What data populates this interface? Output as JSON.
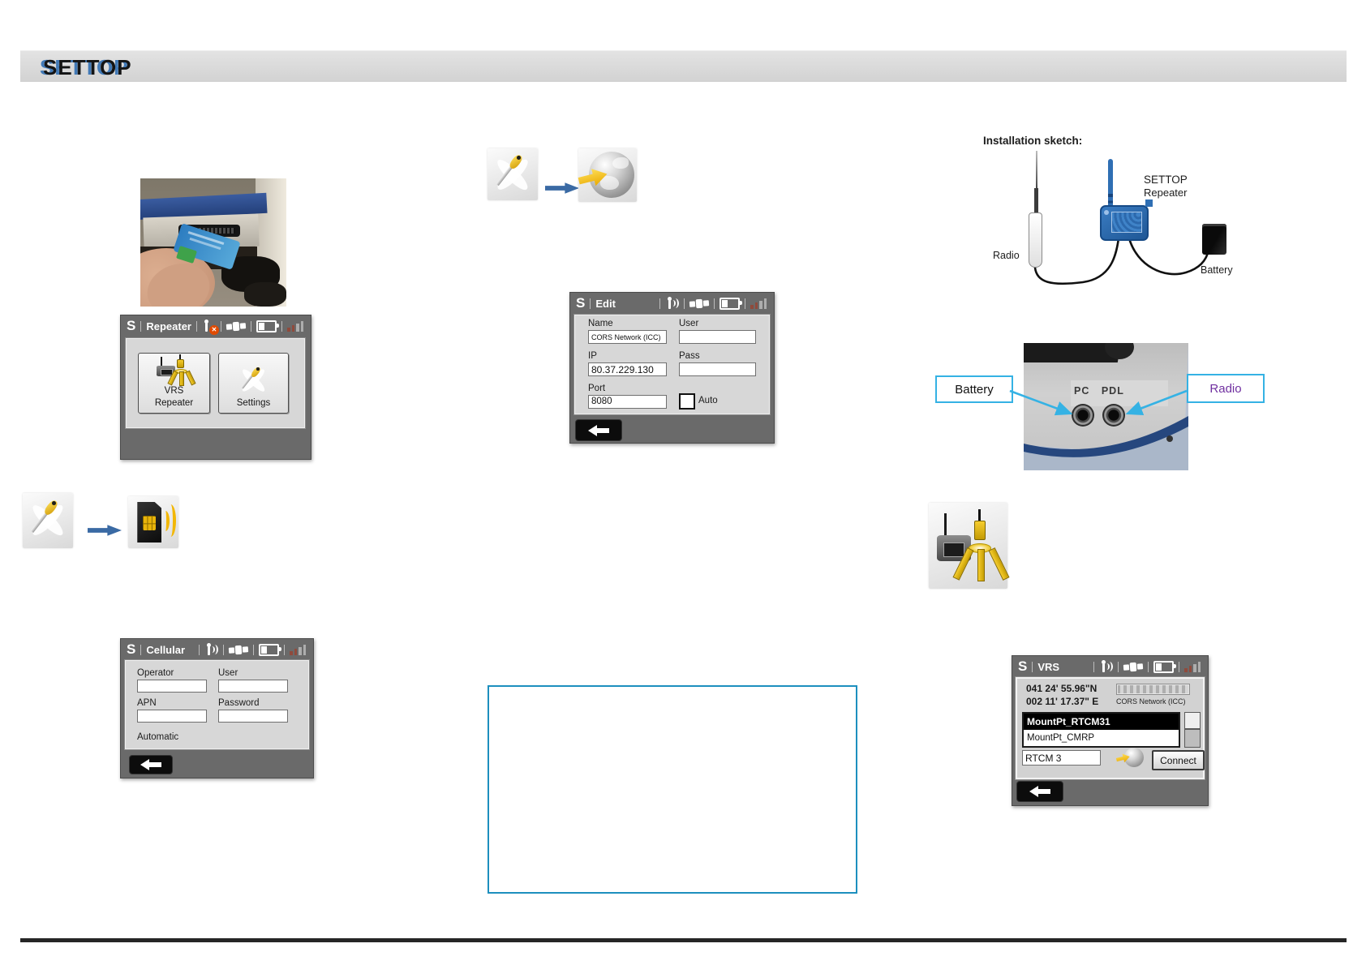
{
  "brand": {
    "logo": "SETTOP"
  },
  "icons": {
    "close_glyph": "✕"
  },
  "colors": {
    "accent_blue": "#2f6fb4",
    "annotation_cyan": "#35b2e4",
    "radio_label_purple": "#7030a0",
    "note_box_border": "#1d8fbe",
    "selected_row_bg": "#000000"
  },
  "screens": {
    "repeater": {
      "logo": "S",
      "title": "Repeater",
      "buttons": [
        {
          "label": "VRS Repeater"
        },
        {
          "label": "Settings"
        }
      ]
    },
    "cellular": {
      "logo": "S",
      "title": "Cellular",
      "fields": [
        {
          "label": "Operator",
          "value": ""
        },
        {
          "label": "User",
          "value": ""
        },
        {
          "label": "APN",
          "value": ""
        },
        {
          "label": "Password",
          "value": ""
        }
      ],
      "automatic_label": "Automatic"
    },
    "edit": {
      "logo": "S",
      "title": "Edit",
      "name_label": "Name",
      "name_value": "CORS Network (ICC)",
      "user_label": "User",
      "user_value": "",
      "ip_label": "IP",
      "ip_value": "80.37.229.130",
      "pass_label": "Pass",
      "pass_value": "",
      "port_label": "Port",
      "port_value": "8080",
      "auto_label": "Auto"
    },
    "vrs": {
      "logo": "S",
      "title": "VRS",
      "latitude": "041 24' 55.96\"N",
      "longitude": "002 11' 17.37\" E",
      "network": "CORS Network (ICC)",
      "mount_points": [
        {
          "label": "MountPt_RTCM31",
          "selected": true
        },
        {
          "label": "MountPt_CMRP",
          "selected": false
        }
      ],
      "format_value": "RTCM 3",
      "connect_label": "Connect"
    }
  },
  "sketch": {
    "title": "Installation sketch:",
    "radio_label": "Radio",
    "device_label_line1": "SETTOP",
    "device_label_line2": "Repeater",
    "battery_label": "Battery"
  },
  "ports": {
    "battery_label": "Battery",
    "radio_label": "Radio",
    "panel_label": "PC PDL"
  }
}
